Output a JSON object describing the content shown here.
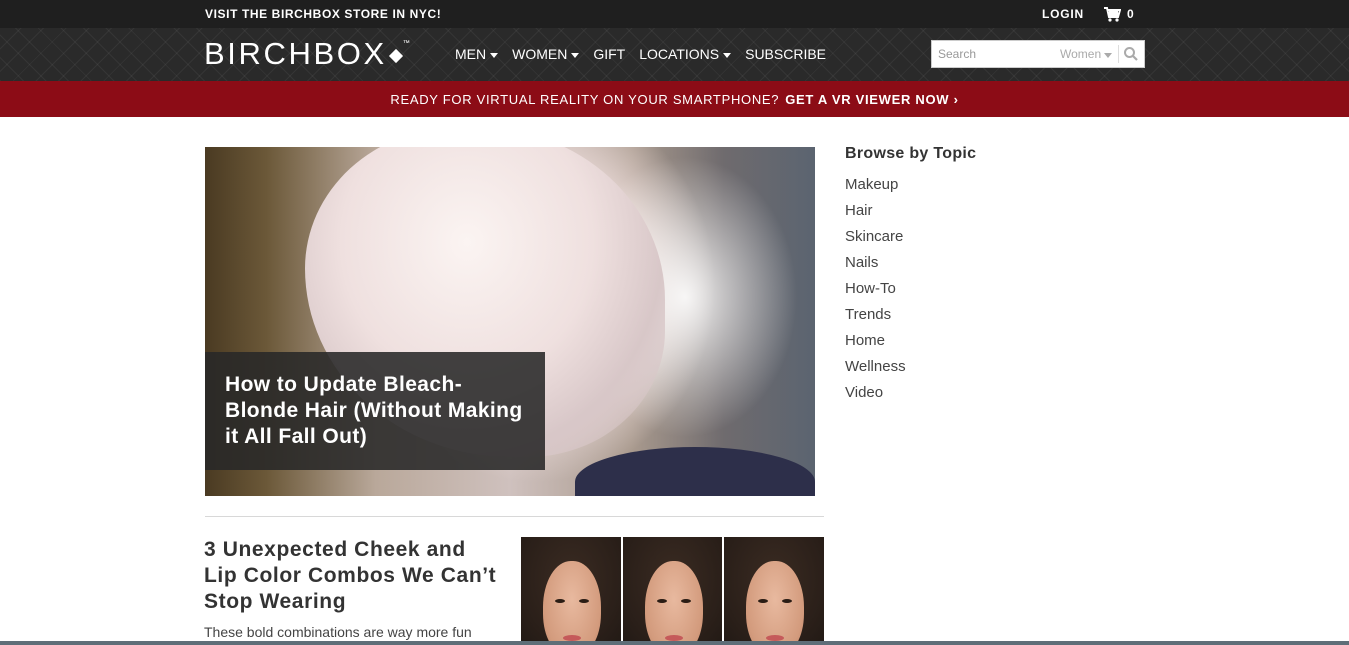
{
  "topbar": {
    "promo": "VISIT THE BIRCHBOX STORE IN NYC!",
    "login": "LOGIN",
    "cart_count": "0"
  },
  "nav": {
    "logo": "BIRCHBOX",
    "logo_tm": "™",
    "items": [
      {
        "label": "MEN",
        "dropdown": true
      },
      {
        "label": "WOMEN",
        "dropdown": true
      },
      {
        "label": "GIFT",
        "dropdown": false
      },
      {
        "label": "LOCATIONS",
        "dropdown": true
      },
      {
        "label": "SUBSCRIBE",
        "dropdown": false
      }
    ],
    "search": {
      "placeholder": "Search",
      "category": "Women"
    }
  },
  "banner": {
    "text": "READY FOR VIRTUAL REALITY ON YOUR SMARTPHONE?",
    "cta": "GET A VR VIEWER NOW ›"
  },
  "hero": {
    "title": "How to Update Bleach-Blonde Hair (Without Making it All Fall Out)"
  },
  "article": {
    "title": "3 Unexpected Cheek and Lip Color Combos We Can’t Stop Wearing",
    "description": "These bold combinations are way more fun"
  },
  "sidebar": {
    "heading": "Browse by Topic",
    "topics": [
      "Makeup",
      "Hair",
      "Skincare",
      "Nails",
      "How-To",
      "Trends",
      "Home",
      "Wellness",
      "Video"
    ]
  },
  "colors": {
    "topbar_bg": "#1f1f1f",
    "banner_bg": "#8c0c16",
    "text": "#333333"
  },
  "icons": {
    "cart": "shopping-cart-icon",
    "search": "search-icon",
    "dropdown": "caret-down-icon"
  }
}
